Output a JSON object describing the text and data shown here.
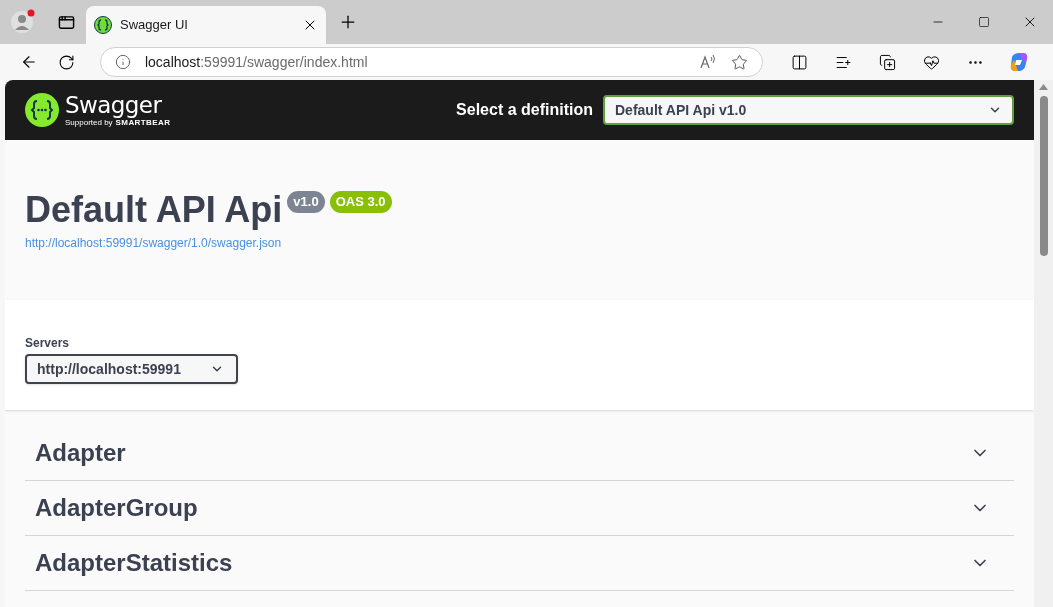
{
  "browser": {
    "tab": {
      "title": "Swagger UI",
      "selected": true
    },
    "address": {
      "host": "localhost",
      "path": ":59991/swagger/index.html"
    }
  },
  "topbar": {
    "logo": {
      "name": "Swagger",
      "supported_by": "Supported by",
      "brand": "SMARTBEAR"
    },
    "definition_label": "Select a definition",
    "definition_value": "Default API Api v1.0"
  },
  "info": {
    "title": "Default API Api",
    "version": "v1.0",
    "oas": "OAS 3.0",
    "url": "http://localhost:59991/swagger/1.0/swagger.json"
  },
  "servers": {
    "label": "Servers",
    "value": "http://localhost:59991"
  },
  "tags": [
    {
      "name": "Adapter",
      "expanded": false
    },
    {
      "name": "AdapterGroup",
      "expanded": false
    },
    {
      "name": "AdapterStatistics",
      "expanded": false
    }
  ]
}
